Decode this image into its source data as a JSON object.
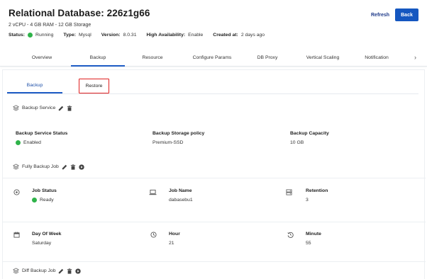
{
  "header": {
    "title": "Relational Database: 226z1g66",
    "subtitle": "2 vCPU - 4 GB RAM - 12 GB Storage",
    "meta": [
      {
        "key": "Status:",
        "value": "Running",
        "status_color": "#2fb34a"
      },
      {
        "key": "Type:",
        "value": "Mysql"
      },
      {
        "key": "Version:",
        "value": "8.0.31"
      },
      {
        "key": "High Availability:",
        "value": "Enable"
      },
      {
        "key": "Created at:",
        "value": "2 days ago"
      }
    ],
    "refresh_label": "Refresh",
    "back_label": "Back"
  },
  "tabs": [
    "Overview",
    "Backup",
    "Resource",
    "Configure Params",
    "DB Proxy",
    "Vertical Scaling",
    "Notification"
  ],
  "active_tab": "Backup",
  "subtabs": {
    "backup": "Backup",
    "restore": "Restore"
  },
  "backup_service": {
    "title": "Backup Service",
    "fields": [
      {
        "label": "Backup Service Status",
        "value": "Enabled",
        "status_color": "#2fb34a"
      },
      {
        "label": "Backup Storage policy",
        "value": "Premium-SSD"
      },
      {
        "label": "Backup Capacity",
        "value": "10 GB"
      }
    ]
  },
  "fully_backup_job": {
    "title": "Fully Backup Job",
    "fields": [
      {
        "icon": "clock-circle-icon",
        "label": "Job Status",
        "value": "Ready",
        "status_color": "#2fb34a"
      },
      {
        "icon": "laptop-icon",
        "label": "Job Name",
        "value": "dabasebu1"
      },
      {
        "icon": "server-icon",
        "label": "Retention",
        "value": "3"
      },
      {
        "icon": "calendar-icon",
        "label": "Day Of Week",
        "value": "Saturday"
      },
      {
        "icon": "clock-icon",
        "label": "Hour",
        "value": "21"
      },
      {
        "icon": "history-icon",
        "label": "Minute",
        "value": "55"
      }
    ]
  },
  "diff_backup_job": {
    "title": "Diff Backup Job"
  },
  "colors": {
    "accent": "#1557c0",
    "success": "#2fb34a",
    "highlight": "#e02020"
  }
}
